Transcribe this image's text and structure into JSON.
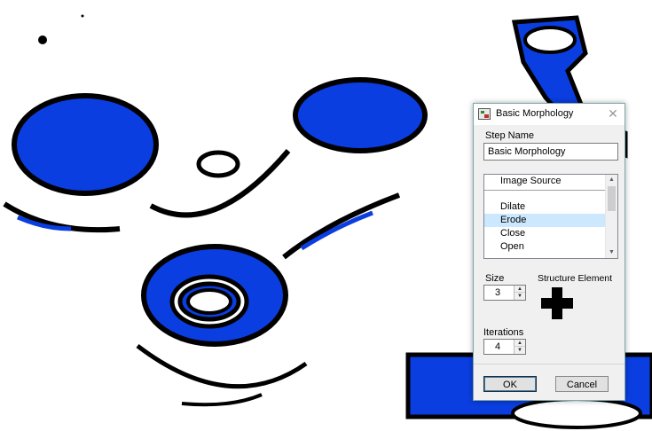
{
  "dialog": {
    "title": "Basic Morphology",
    "app_icon": "morphology-app-icon",
    "close_label": "✕",
    "step_name_label": "Step Name",
    "step_name_value": "Basic Morphology",
    "operations": [
      {
        "label": "Image Source",
        "selected": false
      },
      {
        "label": "Dilate",
        "selected": false
      },
      {
        "label": "Erode",
        "selected": true
      },
      {
        "label": "Close",
        "selected": false
      },
      {
        "label": "Open",
        "selected": false
      }
    ],
    "size_label": "Size",
    "size_value": "3",
    "structure_label": "Structure Element",
    "structure_shape": "cross",
    "iterations_label": "Iterations",
    "iterations_value": "4",
    "ok_label": "OK",
    "cancel_label": "Cancel"
  },
  "colors": {
    "fill_blue": "#0a3ee0",
    "outline": "#000000",
    "selection": "#cce8ff"
  }
}
